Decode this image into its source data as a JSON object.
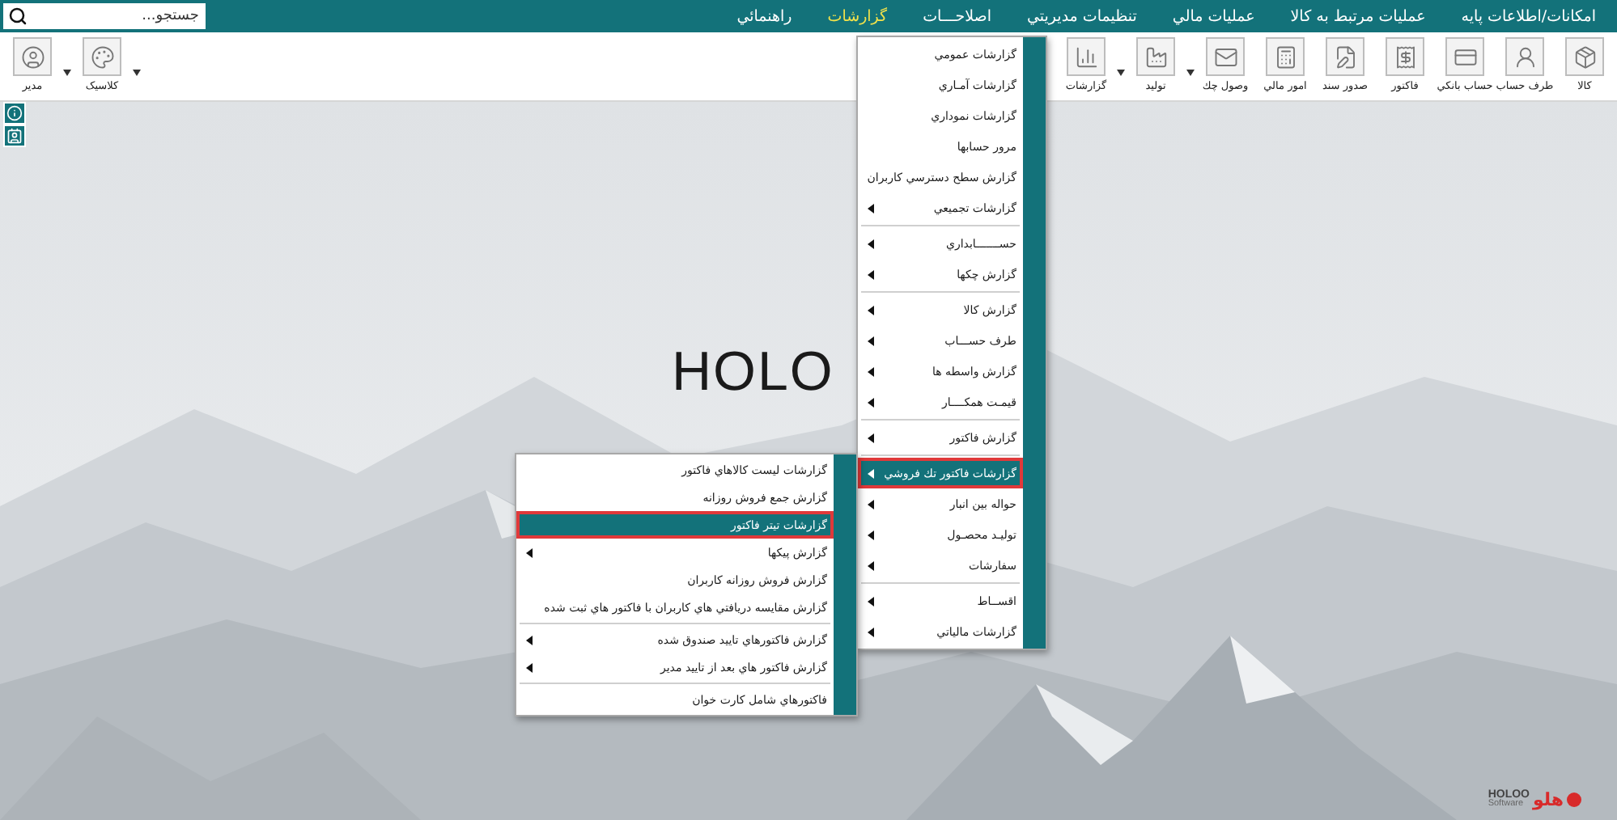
{
  "menubar": {
    "items": [
      {
        "label": "امكانات/اطلاعات پايه",
        "selected": false
      },
      {
        "label": "عمليات مرتبط به كالا",
        "selected": false
      },
      {
        "label": "عمليات مالي",
        "selected": false
      },
      {
        "label": "تنظيمات مديريتي",
        "selected": false
      },
      {
        "label": "اصلاحـــات",
        "selected": false
      },
      {
        "label": "گزارشات",
        "selected": true
      },
      {
        "label": "راهنمائي",
        "selected": false
      }
    ],
    "search": {
      "placeholder": "جستجو..."
    }
  },
  "toolbar": {
    "main": [
      {
        "label": "كالا",
        "dropdown": false
      },
      {
        "label": "طرف حساب",
        "dropdown": false
      },
      {
        "label": "حساب بانكي",
        "dropdown": false
      },
      {
        "label": "فاكتور",
        "dropdown": false
      },
      {
        "label": "صدور سند",
        "dropdown": false
      },
      {
        "label": "امور مالي",
        "dropdown": false
      },
      {
        "label": "وصول چك",
        "dropdown": false
      },
      {
        "label": "توليد",
        "dropdown": true
      },
      {
        "label": "گزارشات",
        "dropdown": true
      }
    ],
    "user": [
      {
        "label": "كلاسيک",
        "dropdown": true
      },
      {
        "label": "مدير",
        "dropdown": true
      }
    ]
  },
  "background_logo": {
    "text": "HOLO"
  },
  "brand": {
    "mark": "هلو",
    "name": "HOLOO",
    "tagline": "Software"
  },
  "reports_menu": {
    "items": [
      {
        "kind": "item",
        "label": "گزارشات عمومي",
        "submenu": false,
        "selected": false
      },
      {
        "kind": "item",
        "label": "گزارشات آمـاري",
        "submenu": false,
        "selected": false
      },
      {
        "kind": "item",
        "label": "گزارشات نموداري",
        "submenu": false,
        "selected": false
      },
      {
        "kind": "item",
        "label": "مرور حسابها",
        "submenu": false,
        "selected": false
      },
      {
        "kind": "item",
        "label": "گزارش سطح دسترسي كاربران",
        "submenu": false,
        "selected": false
      },
      {
        "kind": "item",
        "label": "گزارشات تجميعي",
        "submenu": true,
        "selected": false
      },
      {
        "kind": "separator"
      },
      {
        "kind": "item",
        "label": "حســـــــابداري",
        "submenu": true,
        "selected": false
      },
      {
        "kind": "item",
        "label": "گزارش چكها",
        "submenu": true,
        "selected": false
      },
      {
        "kind": "separator"
      },
      {
        "kind": "item",
        "label": "گزارش كالا",
        "submenu": true,
        "selected": false
      },
      {
        "kind": "item",
        "label": "طرف حســـاب",
        "submenu": true,
        "selected": false
      },
      {
        "kind": "item",
        "label": "گزارش واسطه ها",
        "submenu": true,
        "selected": false
      },
      {
        "kind": "item",
        "label": "قيمـت همكــــار",
        "submenu": true,
        "selected": false
      },
      {
        "kind": "separator"
      },
      {
        "kind": "item",
        "label": "گزارش فاكتور",
        "submenu": true,
        "selected": false
      },
      {
        "kind": "separator"
      },
      {
        "kind": "item",
        "label": "گزارشات فاكتور تك فروشي",
        "submenu": true,
        "selected": true
      },
      {
        "kind": "item",
        "label": "حواله بين انبار",
        "submenu": true,
        "selected": false
      },
      {
        "kind": "item",
        "label": "توليـد محصـول",
        "submenu": true,
        "selected": false
      },
      {
        "kind": "item",
        "label": "سفارشات",
        "submenu": true,
        "selected": false
      },
      {
        "kind": "separator"
      },
      {
        "kind": "item",
        "label": "اقســاط",
        "submenu": true,
        "selected": false
      },
      {
        "kind": "item",
        "label": "گزارشات مالياتي",
        "submenu": true,
        "selected": false
      }
    ]
  },
  "invoice_submenu": {
    "items": [
      {
        "kind": "item",
        "label": "گزارشات ليست كالاهاي فاكتور",
        "submenu": false,
        "selected": false
      },
      {
        "kind": "item",
        "label": "گزارش جمع فروش روزانه",
        "submenu": false,
        "selected": false
      },
      {
        "kind": "item",
        "label": "گزارشات تيتر فاكتور",
        "submenu": false,
        "selected": true
      },
      {
        "kind": "item",
        "label": "گزارش پيكها",
        "submenu": true,
        "selected": false
      },
      {
        "kind": "item",
        "label": "گزارش فروش روزانه كاربران",
        "submenu": false,
        "selected": false
      },
      {
        "kind": "item",
        "label": "گزارش مقايسه دريافتي هاي  كاربران با فاكتور هاي ثبت شده",
        "submenu": false,
        "selected": false
      },
      {
        "kind": "separator"
      },
      {
        "kind": "item",
        "label": "گزارش فاكتورهاي تاييد صندوق شده",
        "submenu": true,
        "selected": false
      },
      {
        "kind": "item",
        "label": "گزارش فاكتور هاي بعد از تاييد مدير",
        "submenu": true,
        "selected": false
      },
      {
        "kind": "separator"
      },
      {
        "kind": "item",
        "label": "فاكتورهاي شامل كارت خوان",
        "submenu": false,
        "selected": false
      }
    ]
  }
}
